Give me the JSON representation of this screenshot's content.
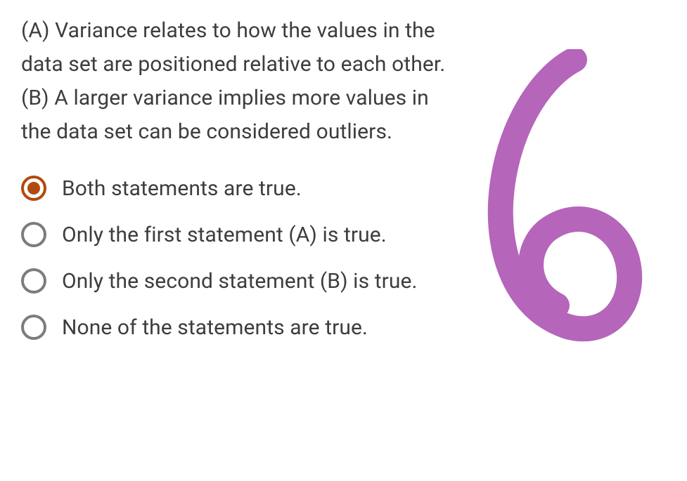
{
  "question": {
    "text": "(A) Variance relates to how the values in the data set are positioned relative to each other. (B) A larger variance implies more values in the data set can be considered outliers."
  },
  "options": [
    {
      "label": "Both statements are true.",
      "selected": true
    },
    {
      "label": "Only the first statement (A) is true.",
      "selected": false
    },
    {
      "label": "Only the second statement (B) is true.",
      "selected": false
    },
    {
      "label": "None of the statements are true.",
      "selected": false
    }
  ],
  "annotation": {
    "glyph": "6",
    "color": "#b565ba"
  }
}
